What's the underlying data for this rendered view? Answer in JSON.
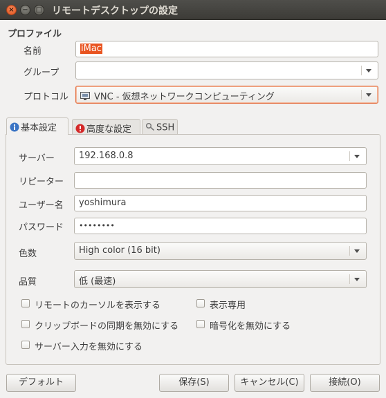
{
  "window": {
    "title": "リモートデスクトップの設定"
  },
  "profile": {
    "section_label": "プロファイル",
    "name_label": "名前",
    "name_value": "iMac",
    "group_label": "グループ",
    "group_value": "",
    "protocol_label": "プロトコル",
    "protocol_value": "VNC - 仮想ネットワークコンピューティング"
  },
  "tabs": [
    {
      "label": "基本設定",
      "icon": "info-icon",
      "active": true
    },
    {
      "label": "高度な設定",
      "icon": "warning-icon",
      "active": false
    },
    {
      "label": "SSH",
      "icon": "key-icon",
      "active": false
    }
  ],
  "basic": {
    "server_label": "サーバー",
    "server_value": "192.168.0.8",
    "repeater_label": "リピーター",
    "repeater_value": "",
    "username_label": "ユーザー名",
    "username_value": "yoshimura",
    "password_label": "パスワード",
    "password_value": "••••••••",
    "color_label": "色数",
    "color_value": "High color (16 bit)",
    "quality_label": "品質",
    "quality_value": "低 (最速)",
    "checkboxes": [
      {
        "label": "リモートのカーソルを表示する",
        "checked": false
      },
      {
        "label": "表示専用",
        "checked": false
      },
      {
        "label": "クリップボードの同期を無効にする",
        "checked": false
      },
      {
        "label": "暗号化を無効にする",
        "checked": false
      },
      {
        "label": "サーバー入力を無効にする",
        "checked": false
      }
    ]
  },
  "buttons": {
    "default": "デフォルト",
    "save": "保存(S)",
    "cancel": "キャンセル(C)",
    "connect": "接続(O)"
  },
  "colors": {
    "accent": "#e95420",
    "titlebar": "#3c3b37",
    "background": "#f2f1f0"
  }
}
